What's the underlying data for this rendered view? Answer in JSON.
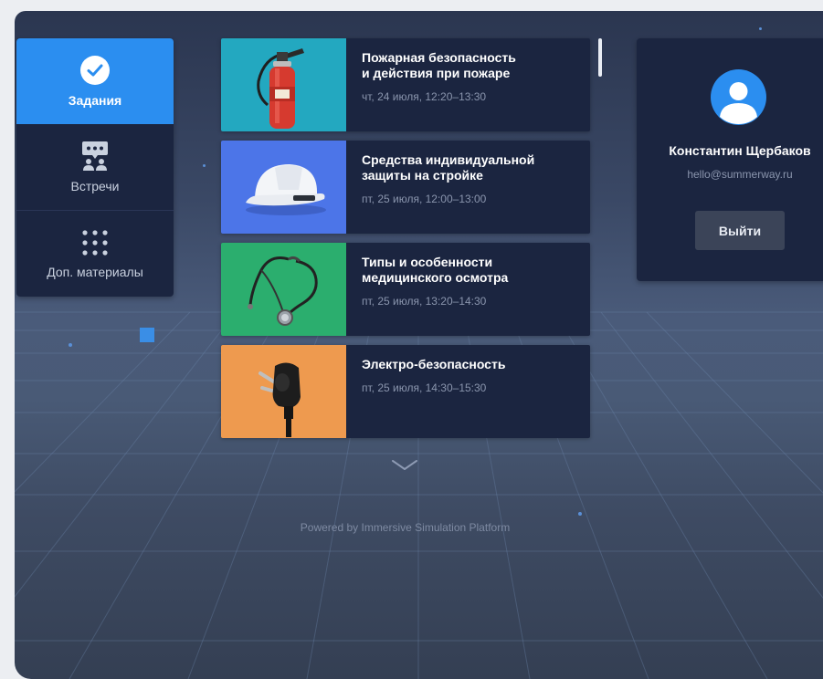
{
  "nav": {
    "items": [
      {
        "label": "Задания",
        "icon": "check-circle-icon",
        "active": true
      },
      {
        "label": "Встречи",
        "icon": "meeting-icon",
        "active": false
      },
      {
        "label": "Доп. материалы",
        "icon": "grid-dots-icon",
        "active": false
      }
    ]
  },
  "sessions": [
    {
      "title": "Пожарная безопасность\nи действия при пожаре",
      "time": "чт, 24 июля, 12:20–13:30",
      "thumb_color": "#23a8c0",
      "icon": "fire-extinguisher-icon"
    },
    {
      "title": "Средства индивидуальной\nзащиты на стройке",
      "time": "пт, 25 июля, 12:00–13:00",
      "thumb_color": "#4c75e8",
      "icon": "hard-hat-icon"
    },
    {
      "title": "Типы и особенности\nмедицинского осмотра",
      "time": "пт, 25 июля, 13:20–14:30",
      "thumb_color": "#2bae6e",
      "icon": "stethoscope-icon"
    },
    {
      "title": "Электро-безопасность",
      "time": "пт, 25 июля, 14:30–15:30",
      "thumb_color": "#ee9a4f",
      "icon": "power-plug-icon"
    }
  ],
  "footer": {
    "text": "Powered by Immersive Simulation Platform"
  },
  "profile": {
    "name": "Константин Щербаков",
    "email": "hello@summerway.ru",
    "logout_label": "Выйти"
  },
  "colors": {
    "accent": "#2b8ef0",
    "panel": "#1b2540"
  }
}
